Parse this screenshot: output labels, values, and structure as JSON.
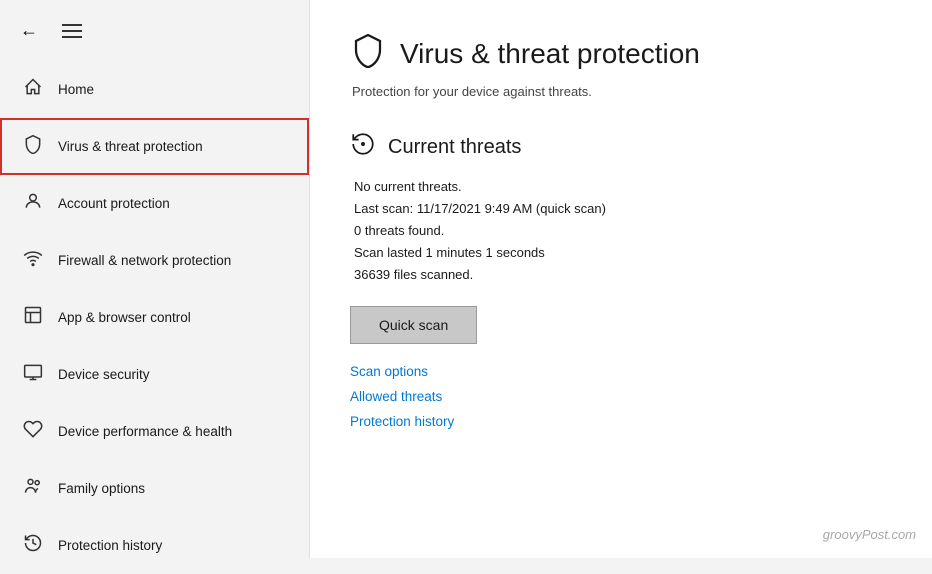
{
  "sidebar": {
    "back_label": "←",
    "menu_label": "≡",
    "items": [
      {
        "id": "home",
        "label": "Home",
        "icon": "🏠",
        "active": false
      },
      {
        "id": "virus-threat",
        "label": "Virus & threat protection",
        "icon": "🛡",
        "active": true
      },
      {
        "id": "account-protection",
        "label": "Account protection",
        "icon": "👤",
        "active": false
      },
      {
        "id": "firewall",
        "label": "Firewall & network protection",
        "icon": "📶",
        "active": false
      },
      {
        "id": "app-browser",
        "label": "App & browser control",
        "icon": "⬜",
        "active": false
      },
      {
        "id": "device-security",
        "label": "Device security",
        "icon": "💻",
        "active": false
      },
      {
        "id": "device-performance",
        "label": "Device performance & health",
        "icon": "♡",
        "active": false
      },
      {
        "id": "family-options",
        "label": "Family options",
        "icon": "⚙",
        "active": false
      },
      {
        "id": "protection-history",
        "label": "Protection history",
        "icon": "↺",
        "active": false
      }
    ]
  },
  "main": {
    "page_title": "Virus & threat protection",
    "page_subtitle": "Protection for your device against threats.",
    "section_title": "Current threats",
    "threat_lines": [
      "No current threats.",
      "Last scan: 11/17/2021 9:49 AM (quick scan)",
      "0 threats found.",
      "Scan lasted 1 minutes 1 seconds",
      "36639 files scanned."
    ],
    "quick_scan_label": "Quick scan",
    "links": [
      {
        "id": "scan-options",
        "label": "Scan options"
      },
      {
        "id": "allowed-threats",
        "label": "Allowed threats"
      },
      {
        "id": "protection-history",
        "label": "Protection history"
      }
    ]
  },
  "watermark": {
    "text": "groovyPost.com"
  }
}
